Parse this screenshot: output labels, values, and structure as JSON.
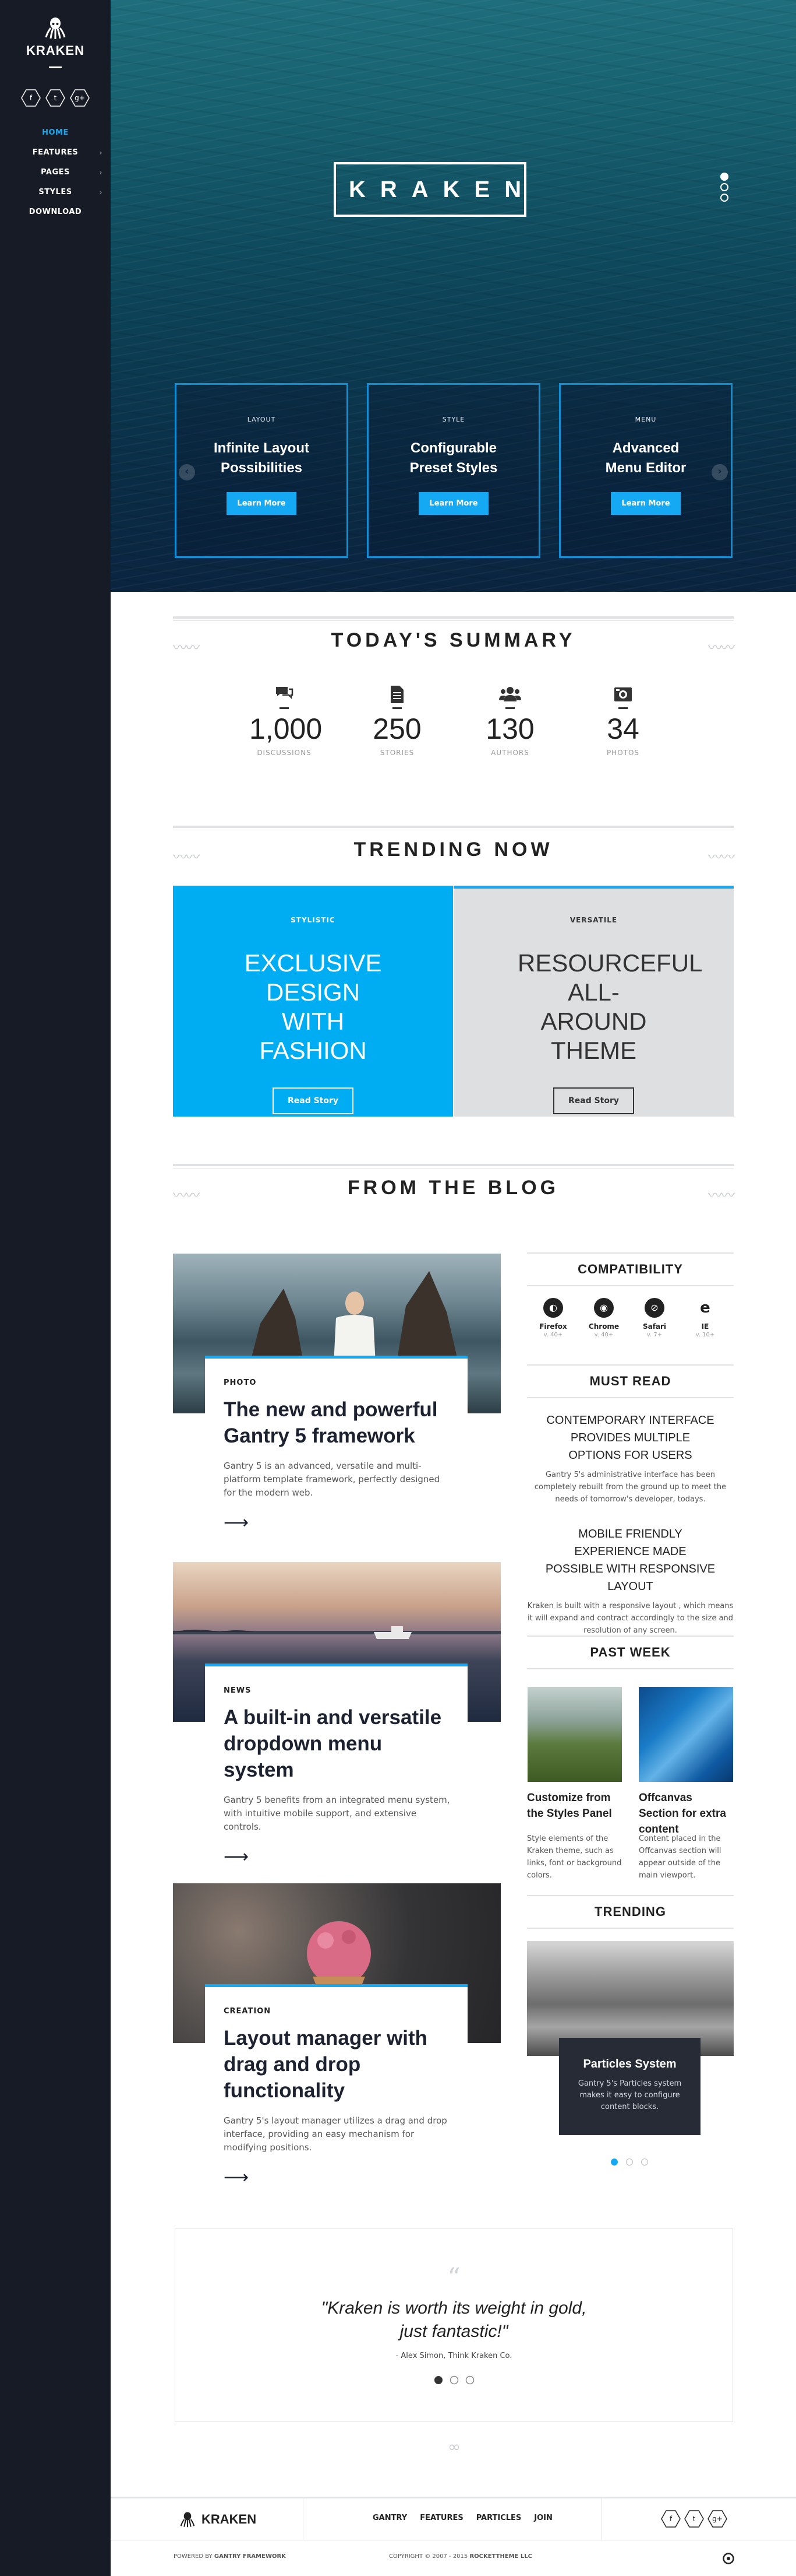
{
  "sidebar": {
    "brand": "KRAKEN",
    "social": [
      {
        "icon": "facebook-icon",
        "glyph": "f"
      },
      {
        "icon": "twitter-icon",
        "glyph": "t"
      },
      {
        "icon": "google-plus-icon",
        "glyph": "g+"
      }
    ],
    "nav": [
      {
        "label": "HOME",
        "active": true,
        "sub": false
      },
      {
        "label": "FEATURES",
        "active": false,
        "sub": true
      },
      {
        "label": "PAGES",
        "active": false,
        "sub": true
      },
      {
        "label": "STYLES",
        "active": false,
        "sub": true
      },
      {
        "label": "DOWNLOAD",
        "active": false,
        "sub": false
      }
    ]
  },
  "hero": {
    "title": "KRAKEN",
    "features": [
      {
        "category": "LAYOUT",
        "title": "Infinite Layout Possibilities",
        "button": "Learn More"
      },
      {
        "category": "STYLE",
        "title": "Configurable Preset Styles",
        "button": "Learn More"
      },
      {
        "category": "MENU",
        "title": "Advanced Menu Editor",
        "button": "Learn More"
      }
    ]
  },
  "summary": {
    "heading": "TODAY'S SUMMARY",
    "stats": [
      {
        "icon": "comments-icon",
        "value": "1,000",
        "label": "DISCUSSIONS"
      },
      {
        "icon": "document-icon",
        "value": "250",
        "label": "STORIES"
      },
      {
        "icon": "users-icon",
        "value": "130",
        "label": "AUTHORS"
      },
      {
        "icon": "camera-icon",
        "value": "34",
        "label": "PHOTOS"
      }
    ]
  },
  "trending": {
    "heading": "TRENDING NOW",
    "cards": [
      {
        "category": "STYLISTIC",
        "title": "EXCLUSIVE DESIGN WITH FASHION",
        "button": "Read Story"
      },
      {
        "category": "VERSATILE",
        "title": "RESOURCEFUL ALL-AROUND THEME",
        "button": "Read Story"
      }
    ]
  },
  "blog": {
    "heading": "FROM THE BLOG",
    "posts": [
      {
        "category": "PHOTO",
        "title": "The new and powerful Gantry 5 framework",
        "text": "Gantry 5 is an advanced, versatile and multi-platform template framework, perfectly designed for the modern web."
      },
      {
        "category": "NEWS",
        "title": "A built-in and versatile dropdown menu system",
        "text": "Gantry 5 benefits from an integrated menu system, with intuitive mobile support, and extensive controls."
      },
      {
        "category": "CREATION",
        "title": "Layout manager with drag and drop functionality",
        "text": "Gantry 5's layout manager utilizes a drag and drop interface, providing an easy mechanism for modifying positions."
      }
    ]
  },
  "widgets": {
    "compat_heading": "COMPATIBILITY",
    "browsers": [
      {
        "icon": "firefox-icon",
        "name": "Firefox",
        "ver": "v. 40+"
      },
      {
        "icon": "chrome-icon",
        "name": "Chrome",
        "ver": "v. 40+"
      },
      {
        "icon": "safari-icon",
        "name": "Safari",
        "ver": "v. 7+"
      },
      {
        "icon": "ie-icon",
        "name": "IE",
        "ver": "v. 10+"
      }
    ],
    "must_heading": "MUST READ",
    "must": [
      {
        "title": "CONTEMPORARY INTERFACE PROVIDES MULTIPLE OPTIONS FOR USERS",
        "text": "Gantry 5's administrative interface has been completely rebuilt from the ground up to meet the needs of tomorrow's developer, todays."
      },
      {
        "title": "MOBILE FRIENDLY EXPERIENCE MADE POSSIBLE WITH RESPONSIVE LAYOUT",
        "text": "Kraken is built with a responsive layout , which means it will expand and contract accordingly to the size and resolution of any screen."
      }
    ],
    "past_heading": "PAST WEEK",
    "past": [
      {
        "title": "Customize from the Styles Panel",
        "text": "Style elements of the Kraken theme, such as links, font or background colors."
      },
      {
        "title": "Offcanvas Section for extra content",
        "text": "Content placed in the Offcanvas section will appear outside of the main viewport."
      }
    ],
    "trend_heading": "TRENDING",
    "trend_card": {
      "title": "Particles System",
      "text": "Gantry 5's Particles system makes it easy to configure content blocks."
    }
  },
  "quote": {
    "text": "\"Kraken is worth its weight in gold, just fantastic!\"",
    "author": "- Alex Simon, Think Kraken Co."
  },
  "footer": {
    "brand": "KRAKEN",
    "links": [
      "GANTRY",
      "FEATURES",
      "PARTICLES",
      "JOIN"
    ],
    "powered_prefix": "POWERED BY",
    "powered_by": "GANTRY FRAMEWORK",
    "copyright_prefix": "COPYRIGHT © 2007 - 2015",
    "copyright_owner": "ROCKETTHEME LLC"
  },
  "colors": {
    "accent": "#16a9f3",
    "sidebar": "#171b25",
    "trend_left": "#00adf2",
    "trend_right": "#dddfe1"
  }
}
